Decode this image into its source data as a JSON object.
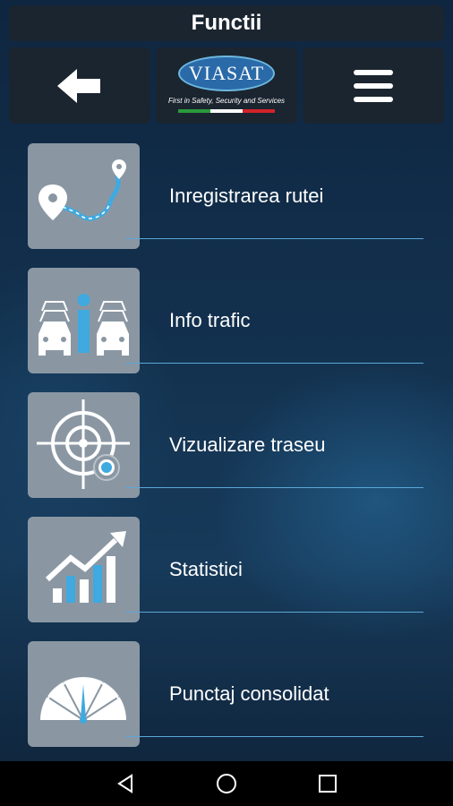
{
  "header": {
    "title": "Functii"
  },
  "toolbar": {
    "back_icon": "arrow-left-icon",
    "menu_icon": "hamburger-menu-icon",
    "logo": {
      "brand": "VIASAT",
      "tagline": "First in Safety, Security and Services",
      "flag_colors": [
        "#2b9a3c",
        "#ffffff",
        "#d2232a"
      ]
    }
  },
  "menu_items": [
    {
      "label": "Inregistrarea rutei",
      "icon": "route-recording-icon"
    },
    {
      "label": "Info trafic",
      "icon": "traffic-info-icon"
    },
    {
      "label": "Vizualizare traseu",
      "icon": "target-locate-icon"
    },
    {
      "label": "Statistici",
      "icon": "statistics-chart-icon"
    },
    {
      "label": "Punctaj consolidat",
      "icon": "gauge-score-icon"
    }
  ],
  "navbar": {
    "back": "nav-back-icon",
    "home": "nav-home-icon",
    "recents": "nav-recents-icon"
  },
  "colors": {
    "accent": "#3fa9e0",
    "tile": "#8a97a3",
    "underline": "#5ba7d6",
    "bar_background": "#1b2530"
  }
}
